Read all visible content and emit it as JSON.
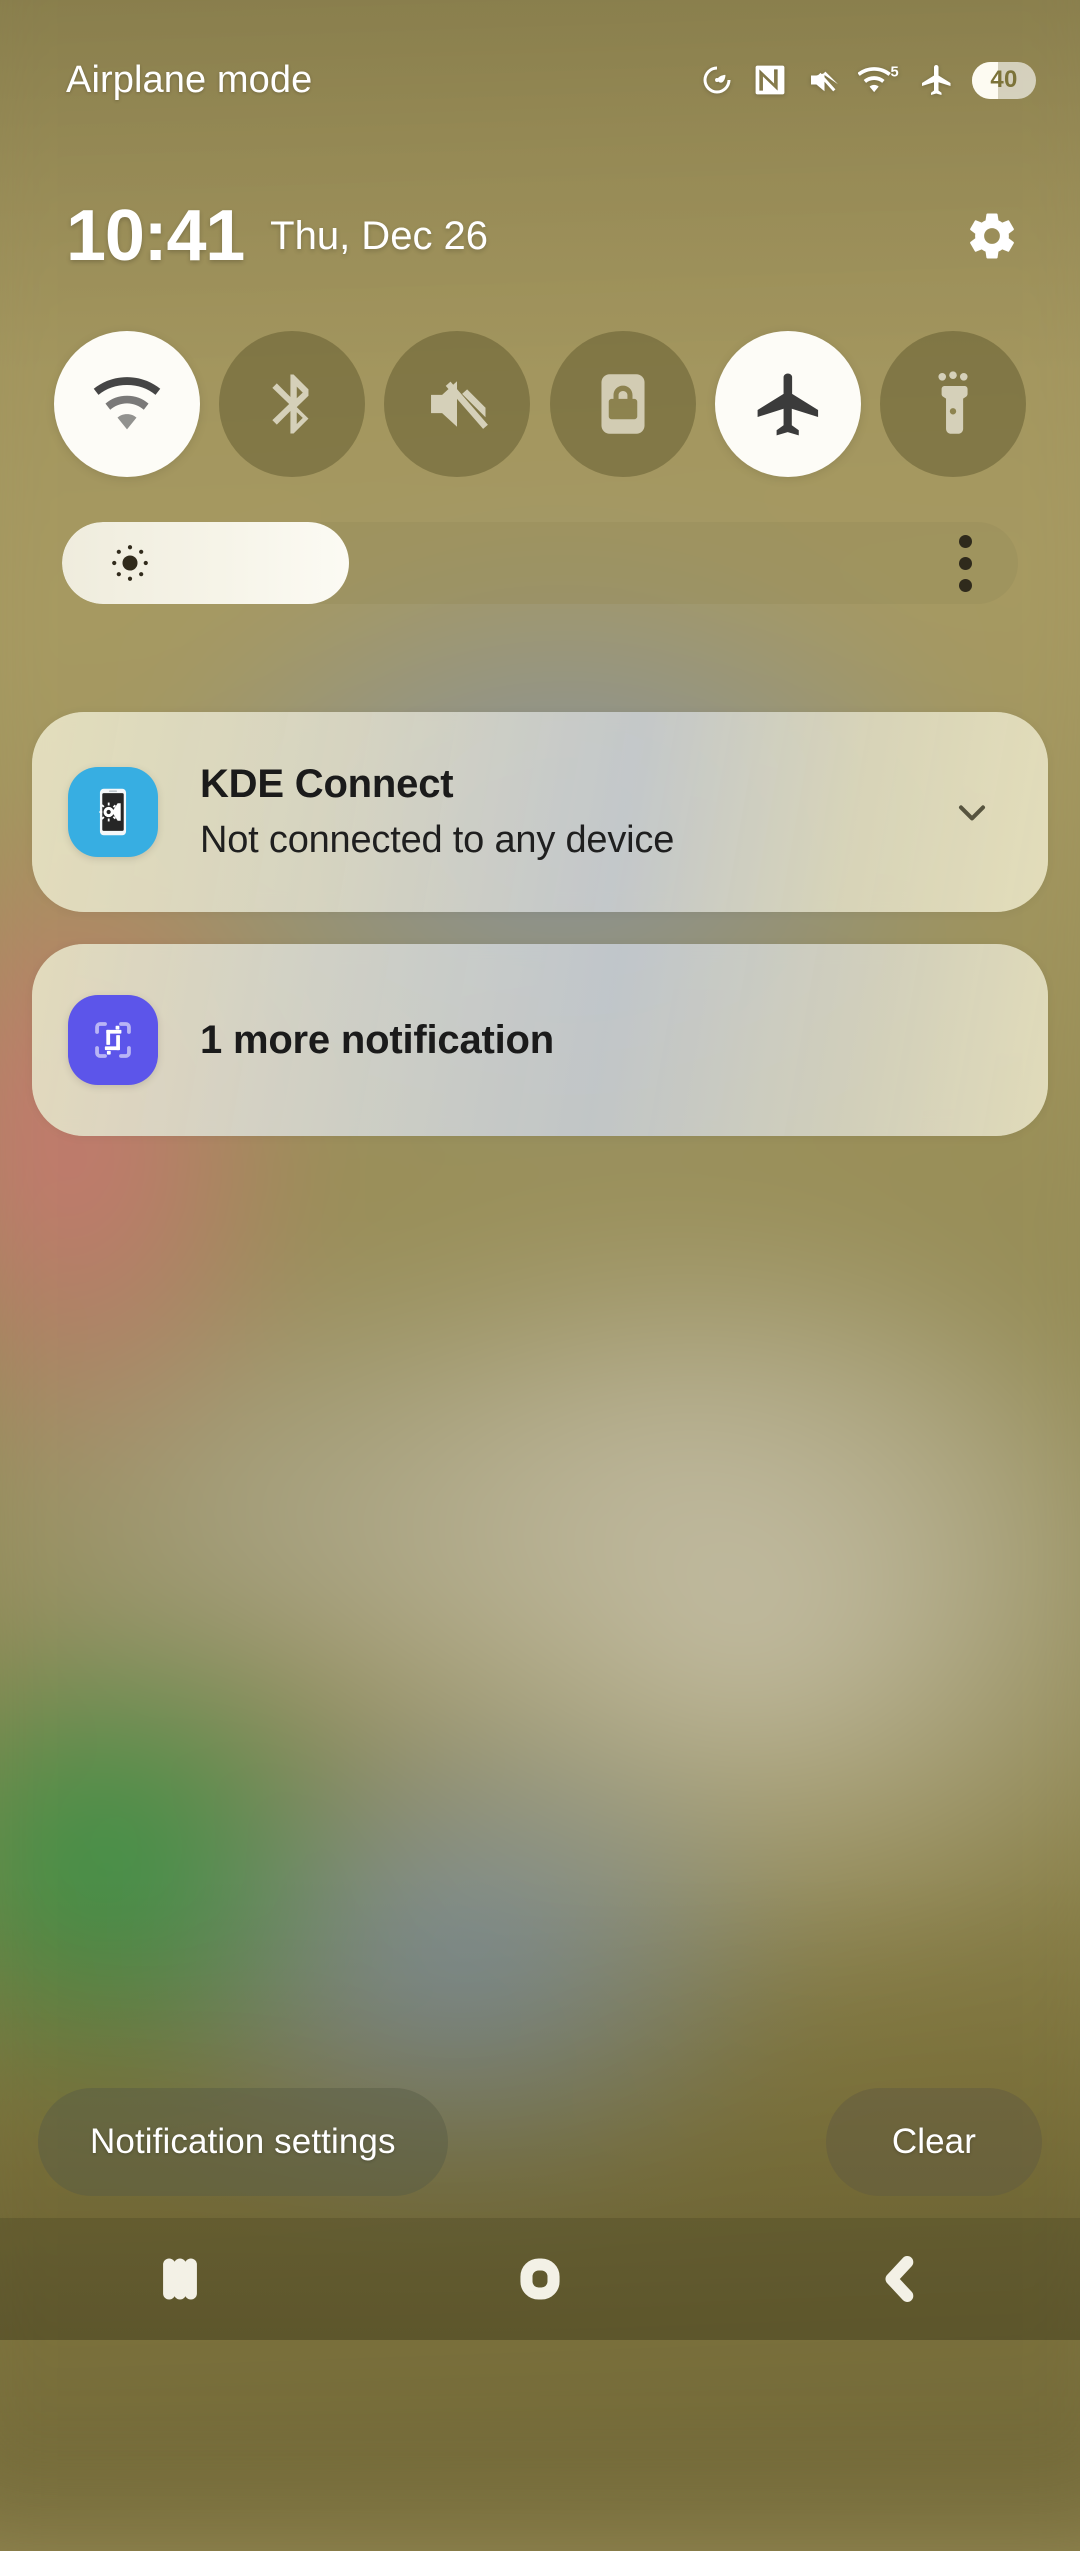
{
  "statusbar": {
    "label": "Airplane mode",
    "icons": [
      {
        "name": "data-saver-icon"
      },
      {
        "name": "nfc-icon"
      },
      {
        "name": "mute-icon"
      },
      {
        "name": "wifi-icon",
        "badge": "5"
      },
      {
        "name": "airplane-mode-icon"
      }
    ],
    "battery": {
      "level": "40",
      "percent": 40
    }
  },
  "header": {
    "time": "10:41",
    "date": "Thu, Dec 26",
    "settings_icon": "gear-icon"
  },
  "quick_settings": {
    "toggles": [
      {
        "label": "Wi-Fi",
        "icon": "wifi-icon",
        "state": "on"
      },
      {
        "label": "Bluetooth",
        "icon": "bluetooth-icon",
        "state": "off"
      },
      {
        "label": "Mute",
        "icon": "mute-icon",
        "state": "off"
      },
      {
        "label": "Auto rotate",
        "icon": "rotation-lock-icon",
        "state": "off"
      },
      {
        "label": "Airplane mode",
        "icon": "airplane-icon",
        "state": "on"
      },
      {
        "label": "Flashlight",
        "icon": "flashlight-icon",
        "state": "off"
      }
    ]
  },
  "brightness": {
    "icon": "brightness-sun-icon",
    "value_percent": 30,
    "menu_icon": "overflow-menu-icon"
  },
  "notifications": [
    {
      "app": "KDE Connect",
      "title": "KDE Connect",
      "text": "Not connected to any device",
      "icon": "kde-connect-icon",
      "icon_color": "#37aee2",
      "expand_icon": "chevron-down-icon"
    },
    {
      "app": "More notifications",
      "title": "1 more notification",
      "icon": "screenshot-capture-icon",
      "icon_color": "#5c55ea"
    }
  ],
  "footer": {
    "notification_settings_label": "Notification settings",
    "clear_label": "Clear"
  },
  "navbar": {
    "recents_icon": "recents-icon",
    "home_icon": "home-icon",
    "back_icon": "back-icon"
  },
  "colors": {
    "background": "#9d9059",
    "accent_on": "#fdfcf7",
    "kde_blue": "#37aee2",
    "capture_purple": "#5c55ea"
  }
}
